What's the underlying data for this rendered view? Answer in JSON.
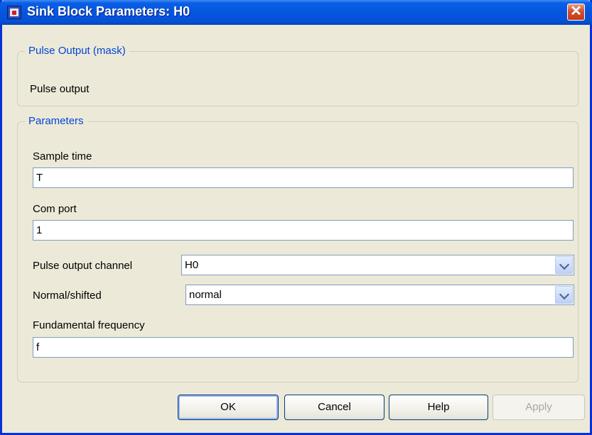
{
  "window": {
    "title": "Sink Block Parameters: H0",
    "close_symbol": "✕"
  },
  "mask_group": {
    "legend": "Pulse Output (mask)",
    "description": "Pulse output"
  },
  "params_group": {
    "legend": "Parameters",
    "sample_time": {
      "label": "Sample time",
      "value": "T"
    },
    "com_port": {
      "label": "Com port",
      "value": "1"
    },
    "pulse_channel": {
      "label": "Pulse output channel",
      "value": "H0"
    },
    "normal_shifted": {
      "label": "Normal/shifted",
      "value": "normal"
    },
    "fund_freq": {
      "label": "Fundamental frequency",
      "value": "f"
    }
  },
  "buttons": {
    "ok": "OK",
    "cancel": "Cancel",
    "help": "Help",
    "apply": "Apply"
  },
  "icons": {
    "app": "simulink-block-icon",
    "close": "close-icon",
    "dropdown": "chevron-down-icon"
  },
  "colors": {
    "titlebar": "#0655de",
    "window_bg": "#ece9d8",
    "group_legend": "#0046d5",
    "close_button": "#d2502d"
  }
}
